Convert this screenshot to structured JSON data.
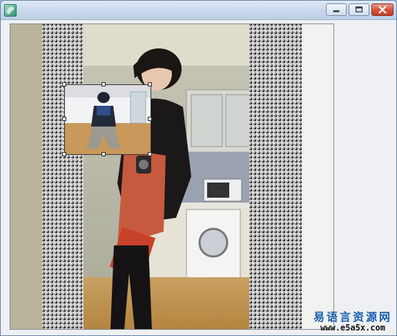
{
  "window": {
    "title": "",
    "colors": {
      "titlebar": "#c9d9ec",
      "close": "#d6543e",
      "client": "#eef0f3"
    },
    "buttons": [
      {
        "name": "minimize",
        "icon": "minimize-icon"
      },
      {
        "name": "maximize",
        "icon": "maximize-icon"
      },
      {
        "name": "close",
        "icon": "close-icon"
      }
    ]
  },
  "canvas": {
    "main_image": "photo of a person taking a mirror selfie in a kitchen",
    "overlay_image": "thumbnail of a dancer in a studio",
    "selection_handles": 8
  },
  "watermark": {
    "title": "易语言资源网",
    "url": "www.e5a5x.com"
  }
}
